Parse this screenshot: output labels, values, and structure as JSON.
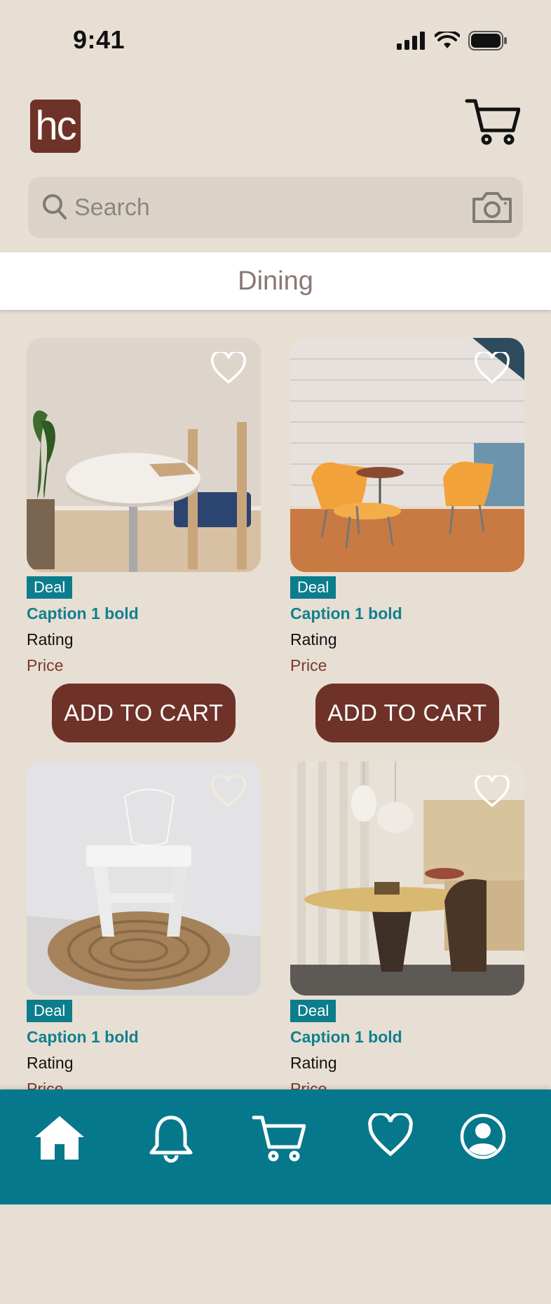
{
  "status": {
    "time": "9:41"
  },
  "header": {
    "logo_text": "hc"
  },
  "search": {
    "placeholder": "Search"
  },
  "category": {
    "title": "Dining"
  },
  "products": [
    {
      "deal": "Deal",
      "caption": "Caption 1 bold",
      "rating": "Rating",
      "price": "Price",
      "button": "ADD TO CART"
    },
    {
      "deal": "Deal",
      "caption": "Caption 1 bold",
      "rating": "Rating",
      "price": "Price",
      "button": "ADD TO CART"
    },
    {
      "deal": "Deal",
      "caption": "Caption 1 bold",
      "rating": "Rating",
      "price": "Price"
    },
    {
      "deal": "Deal",
      "caption": "Caption 1 bold",
      "rating": "Rating",
      "price": "Price"
    }
  ],
  "nav": [
    "home-icon",
    "bell-icon",
    "cart-icon",
    "heart-icon",
    "profile-icon"
  ],
  "colors": {
    "background": "#e7dfd3",
    "brand_brown": "#6f3228",
    "teal": "#06788b",
    "caption_teal": "#12808f",
    "price": "#7a3a2e"
  }
}
